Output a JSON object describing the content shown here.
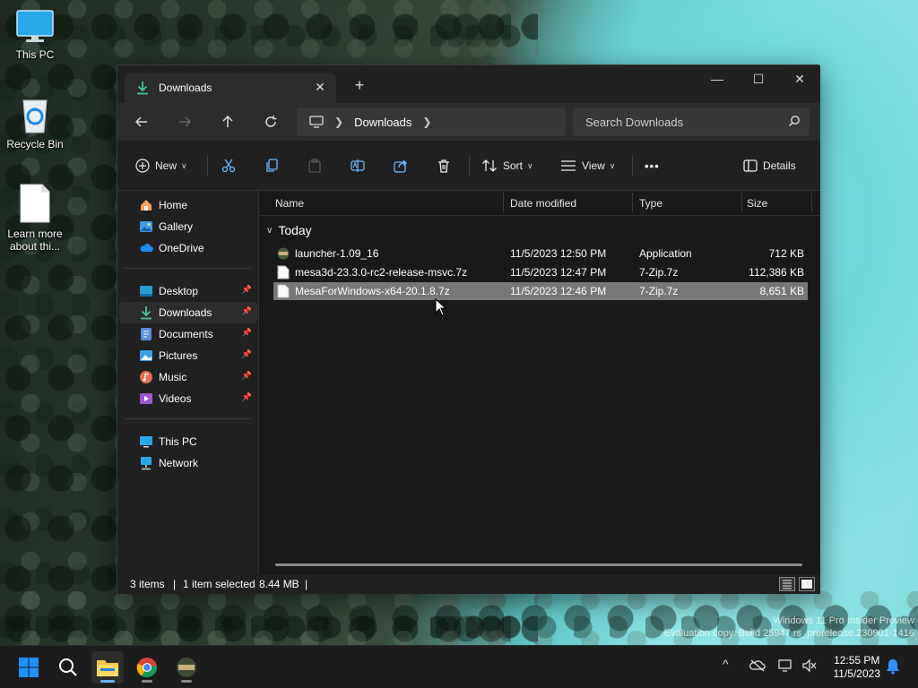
{
  "desktop": {
    "icons": [
      {
        "label": "This PC"
      },
      {
        "label": "Recycle Bin"
      },
      {
        "label": "Learn more about thi..."
      }
    ],
    "watermark": {
      "line1": "Windows 11 Pro Insider Preview",
      "line2": "Evaluation copy. Build 25947.rs_prerelease.230901-1416"
    }
  },
  "window": {
    "tab_title": "Downloads",
    "tab_close": "✕",
    "new_tab": "+",
    "controls": {
      "minimize": "—",
      "maximize": "☐",
      "close": "✕"
    },
    "breadcrumb": {
      "current": "Downloads"
    },
    "search_placeholder": "Search Downloads",
    "toolbar": {
      "new_label": "New",
      "sort_label": "Sort",
      "view_label": "View",
      "more_label": "•••",
      "details_label": "Details"
    },
    "sidebar": {
      "items": [
        {
          "label": "Home"
        },
        {
          "label": "Gallery"
        },
        {
          "label": "OneDrive"
        },
        {
          "label": "Desktop"
        },
        {
          "label": "Downloads"
        },
        {
          "label": "Documents"
        },
        {
          "label": "Pictures"
        },
        {
          "label": "Music"
        },
        {
          "label": "Videos"
        },
        {
          "label": "This PC"
        },
        {
          "label": "Network"
        }
      ]
    },
    "columns": {
      "name": "Name",
      "date": "Date modified",
      "type": "Type",
      "size": "Size"
    },
    "group": "Today",
    "files": [
      {
        "name": "launcher-1.09_16",
        "date": "11/5/2023 12:50 PM",
        "type": "Application",
        "size": "712 KB"
      },
      {
        "name": "mesa3d-23.3.0-rc2-release-msvc.7z",
        "date": "11/5/2023 12:47 PM",
        "type": "7-Zip.7z",
        "size": "112,386 KB"
      },
      {
        "name": "MesaForWindows-x64-20.1.8.7z",
        "date": "11/5/2023 12:46 PM",
        "type": "7-Zip.7z",
        "size": "8,651 KB"
      }
    ],
    "status": {
      "items": "3 items",
      "selected": "1 item selected",
      "size": "8.44 MB",
      "sep": "|"
    }
  },
  "taskbar": {
    "clock_time": "12:55 PM",
    "clock_date": "11/5/2023",
    "chevron": "^"
  },
  "colors": {
    "accent": "#0078d4",
    "folder": "#f2c548",
    "selection": "#777777"
  }
}
